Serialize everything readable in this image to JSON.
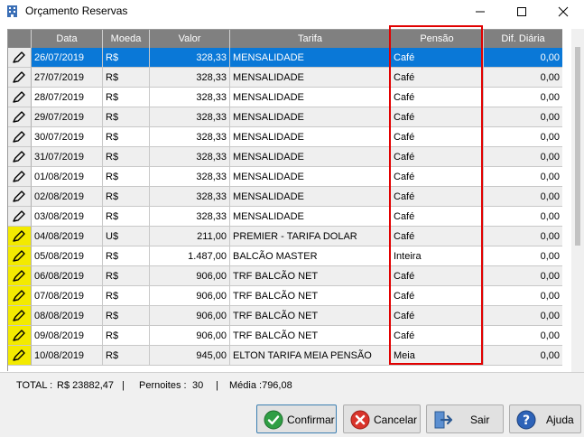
{
  "window": {
    "title": "Orçamento Reservas"
  },
  "columns": {
    "data": "Data",
    "moeda": "Moeda",
    "valor": "Valor",
    "tarifa": "Tarifa",
    "pensao": "Pensão",
    "dif": "Dif. Diária"
  },
  "rows": [
    {
      "data": "26/07/2019",
      "moeda": "R$",
      "valor": "328,33",
      "tarifa": "MENSALIDADE",
      "pensao": "Café",
      "dif": "0,00"
    },
    {
      "data": "27/07/2019",
      "moeda": "R$",
      "valor": "328,33",
      "tarifa": "MENSALIDADE",
      "pensao": "Café",
      "dif": "0,00"
    },
    {
      "data": "28/07/2019",
      "moeda": "R$",
      "valor": "328,33",
      "tarifa": "MENSALIDADE",
      "pensao": "Café",
      "dif": "0,00"
    },
    {
      "data": "29/07/2019",
      "moeda": "R$",
      "valor": "328,33",
      "tarifa": "MENSALIDADE",
      "pensao": "Café",
      "dif": "0,00"
    },
    {
      "data": "30/07/2019",
      "moeda": "R$",
      "valor": "328,33",
      "tarifa": "MENSALIDADE",
      "pensao": "Café",
      "dif": "0,00"
    },
    {
      "data": "31/07/2019",
      "moeda": "R$",
      "valor": "328,33",
      "tarifa": "MENSALIDADE",
      "pensao": "Café",
      "dif": "0,00"
    },
    {
      "data": "01/08/2019",
      "moeda": "R$",
      "valor": "328,33",
      "tarifa": "MENSALIDADE",
      "pensao": "Café",
      "dif": "0,00"
    },
    {
      "data": "02/08/2019",
      "moeda": "R$",
      "valor": "328,33",
      "tarifa": "MENSALIDADE",
      "pensao": "Café",
      "dif": "0,00"
    },
    {
      "data": "03/08/2019",
      "moeda": "R$",
      "valor": "328,33",
      "tarifa": "MENSALIDADE",
      "pensao": "Café",
      "dif": "0,00"
    },
    {
      "data": "04/08/2019",
      "moeda": "U$",
      "valor": "211,00",
      "tarifa": "PREMIER - TARIFA DOLAR",
      "pensao": "Café",
      "dif": "0,00"
    },
    {
      "data": "05/08/2019",
      "moeda": "R$",
      "valor": "1.487,00",
      "tarifa": "BALCÃO MASTER",
      "pensao": "Inteira",
      "dif": "0,00"
    },
    {
      "data": "06/08/2019",
      "moeda": "R$",
      "valor": "906,00",
      "tarifa": "TRF BALCÃO NET",
      "pensao": "Café",
      "dif": "0,00"
    },
    {
      "data": "07/08/2019",
      "moeda": "R$",
      "valor": "906,00",
      "tarifa": "TRF BALCÃO NET",
      "pensao": "Café",
      "dif": "0,00"
    },
    {
      "data": "08/08/2019",
      "moeda": "R$",
      "valor": "906,00",
      "tarifa": "TRF BALCÃO NET",
      "pensao": "Café",
      "dif": "0,00"
    },
    {
      "data": "09/08/2019",
      "moeda": "R$",
      "valor": "906,00",
      "tarifa": "TRF BALCÃO NET",
      "pensao": "Café",
      "dif": "0,00"
    },
    {
      "data": "10/08/2019",
      "moeda": "R$",
      "valor": "945,00",
      "tarifa": "ELTON TARIFA MEIA PENSÃO",
      "pensao": "Meia",
      "dif": "0,00"
    }
  ],
  "row_icon_colors": [
    "grey",
    "grey",
    "grey",
    "grey",
    "grey",
    "grey",
    "grey",
    "grey",
    "grey",
    "yellow",
    "yellow",
    "yellow",
    "yellow",
    "yellow",
    "yellow",
    "yellow"
  ],
  "selected_row": 0,
  "totals": {
    "total_label": "TOTAL :",
    "total_value": "R$ 23882,47",
    "sep1": "|",
    "pernoites_label": "Pernoites :",
    "pernoites_value": "30",
    "sep2": "|",
    "media": "Média :796,08"
  },
  "buttons": {
    "confirmar": "Confirmar",
    "cancelar": "Cancelar",
    "sair": "Sair",
    "ajuda": "Ajuda"
  },
  "colors": {
    "selection": "#0a78d7",
    "header": "#808080",
    "highlight_border": "#e10000",
    "icon_yellow": "#f3ea00"
  },
  "icons": {
    "app": "building-icon",
    "row": "pencil-icon",
    "confirmar": "check-circle-icon",
    "cancelar": "x-circle-icon",
    "sair": "exit-door-icon",
    "ajuda": "help-icon"
  }
}
